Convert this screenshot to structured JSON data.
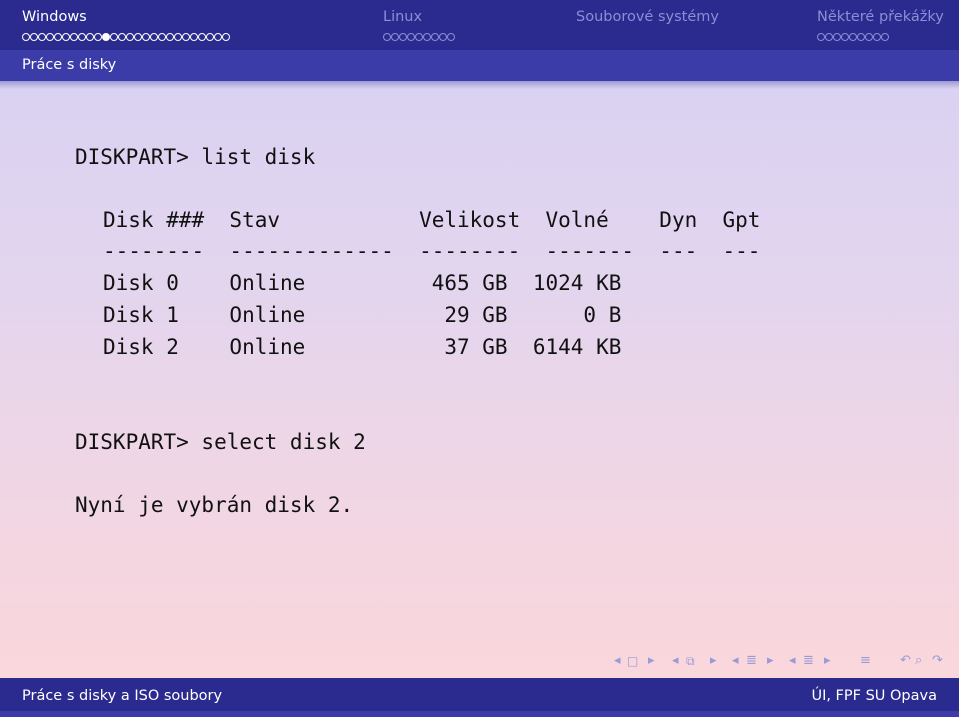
{
  "header": {
    "sections": [
      {
        "title": "Windows",
        "dots": 26,
        "current": 10,
        "active": true
      },
      {
        "title": "Linux",
        "dots": 9,
        "current": -1,
        "active": false
      },
      {
        "title": "Souborové systémy",
        "dots": 0,
        "current": -1,
        "active": false
      },
      {
        "title": "Některé překážky",
        "dots": 9,
        "current": -1,
        "active": false
      }
    ],
    "subsection": "Práce s disky"
  },
  "content": {
    "command1": "DISKPART> list disk",
    "table": {
      "header": "Disk ###  Stav           Velikost  Volné    Dyn  Gpt",
      "separator": "--------  -------------  --------  -------  ---  ---",
      "rows": [
        "Disk 0    Online          465 GB  1024 KB",
        "Disk 1    Online           29 GB      0 B",
        "Disk 2    Online           37 GB  6144 KB"
      ]
    },
    "command2": "DISKPART> select disk 2",
    "result": "Nyní je vybrán disk 2."
  },
  "footer": {
    "left": "Práce s disky a ISO soubory",
    "right": "ÚI, FPF SU Opava"
  },
  "colors": {
    "nav_bg": "#2a2a8f",
    "subbar_bg": "#3c3ca8",
    "inactive_text": "#8d8dd6"
  }
}
